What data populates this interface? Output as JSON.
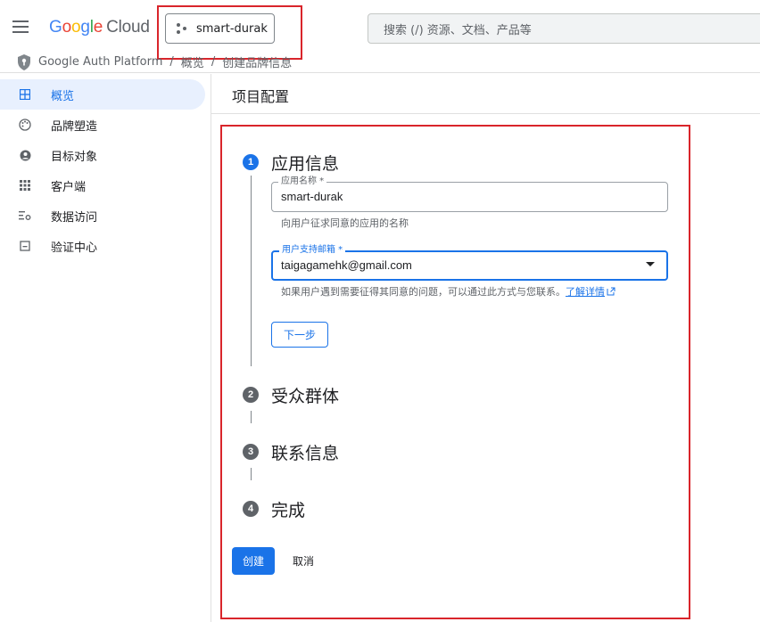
{
  "header": {
    "menu_icon": "hamburger-menu-icon",
    "logo": {
      "google": "Google",
      "cloud": "Cloud"
    },
    "project_selector": {
      "label": "smart-durak",
      "icon": "project-icon"
    },
    "search": {
      "placeholder": "搜索 (/) 资源、文档、产品等"
    }
  },
  "breadcrumb": {
    "icon": "shield-icon",
    "items": [
      "Google Auth Platform",
      "概览",
      "创建品牌信息"
    ],
    "separator": "/"
  },
  "sidebar": {
    "items": [
      {
        "label": "概览",
        "icon": "dashboard-icon",
        "active": true
      },
      {
        "label": "品牌塑造",
        "icon": "palette-icon",
        "active": false
      },
      {
        "label": "目标对象",
        "icon": "person-icon",
        "active": false
      },
      {
        "label": "客户端",
        "icon": "grid-icon",
        "active": false
      },
      {
        "label": "数据访问",
        "icon": "list-settings-icon",
        "active": false
      },
      {
        "label": "验证中心",
        "icon": "check-box-icon",
        "active": false
      }
    ]
  },
  "main": {
    "title": "项目配置",
    "steps": [
      {
        "number": "1",
        "title": "应用信息",
        "active": true
      },
      {
        "number": "2",
        "title": "受众群体",
        "active": false
      },
      {
        "number": "3",
        "title": "联系信息",
        "active": false
      },
      {
        "number": "4",
        "title": "完成",
        "active": false
      }
    ],
    "app_name_field": {
      "label": "应用名称 *",
      "value": "smart-durak",
      "hint": "向用户征求同意的应用的名称"
    },
    "support_email_field": {
      "label": "用户支持邮箱 *",
      "value": "taigagamehk@gmail.com",
      "hint": "如果用户遇到需要征得其同意的问题，可以通过此方式与您联系。",
      "learn_more": "了解详情"
    },
    "next_button": "下一步",
    "create_button": "创建",
    "cancel_button": "取消"
  },
  "colors": {
    "accent": "#1a73e8",
    "highlight_box": "#d9252b",
    "active_nav_bg": "#e8f0fe"
  }
}
